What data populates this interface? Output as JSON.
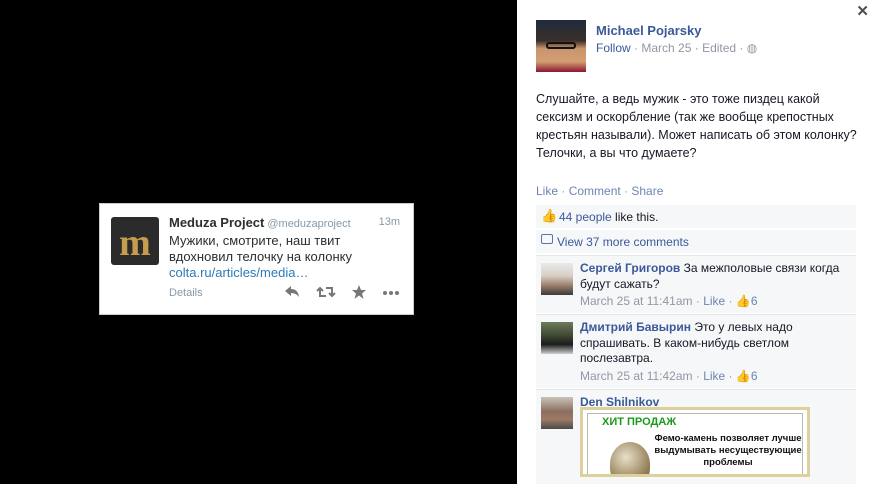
{
  "tweet": {
    "display_name": "Meduza Project",
    "handle": "@meduzaproject",
    "time": "13m",
    "text": "Мужики, смотрите, наш твит вдохновил телочку на колонку",
    "link": "colta.ru/articles/media…",
    "details": "Details",
    "logo_glyph": "m",
    "icons": [
      "reply-icon",
      "retweet-icon",
      "favorite-icon",
      "more-icon"
    ]
  },
  "post": {
    "close_glyph": "✕",
    "author": "Michael Pojarsky",
    "follow": "Follow",
    "sep": " · ",
    "date": "March 25",
    "edited": "Edited",
    "globe_glyph": "◍",
    "text": "Слушайте, а ведь мужик - это тоже пиздец какой сексизм и оскорбление (так же вообще крепостных крестьян называли). Может написать об этом колонку? Телочки, а вы что думаете?",
    "actions": {
      "like": "Like",
      "comment": "Comment",
      "share": "Share"
    }
  },
  "ufi": {
    "thumb_glyph": "👍",
    "likes_count": "44 people",
    "likes_suffix": " like this.",
    "view_more": "View 37 more comments"
  },
  "comments": [
    {
      "author": "Сергей Григоров",
      "text": "За межполовые связи когда будут сажать?",
      "time": "March 25 at 11:41am",
      "like": "Like",
      "likes": "6"
    },
    {
      "author": "Дмитрий Бaвырин",
      "text": "Это у левых надо спрашивать. В каком-нибудь светлом послезавтра.",
      "time": "March 25 at 11:42am",
      "like": "Like",
      "likes": "6"
    },
    {
      "author": "Den Shilnikov",
      "text": "",
      "image_title": "ХИТ ПРОДАЖ",
      "image_text": "Фемо-камень позволяет лучше выдумывать несуществующие проблемы"
    }
  ],
  "colors": {
    "fb_blue": "#3b5998",
    "link_muted": "#6d84b4",
    "meta_gray": "#9197a3",
    "twitter_link": "#2b7bb9",
    "ad_green": "#1a9a1a"
  }
}
